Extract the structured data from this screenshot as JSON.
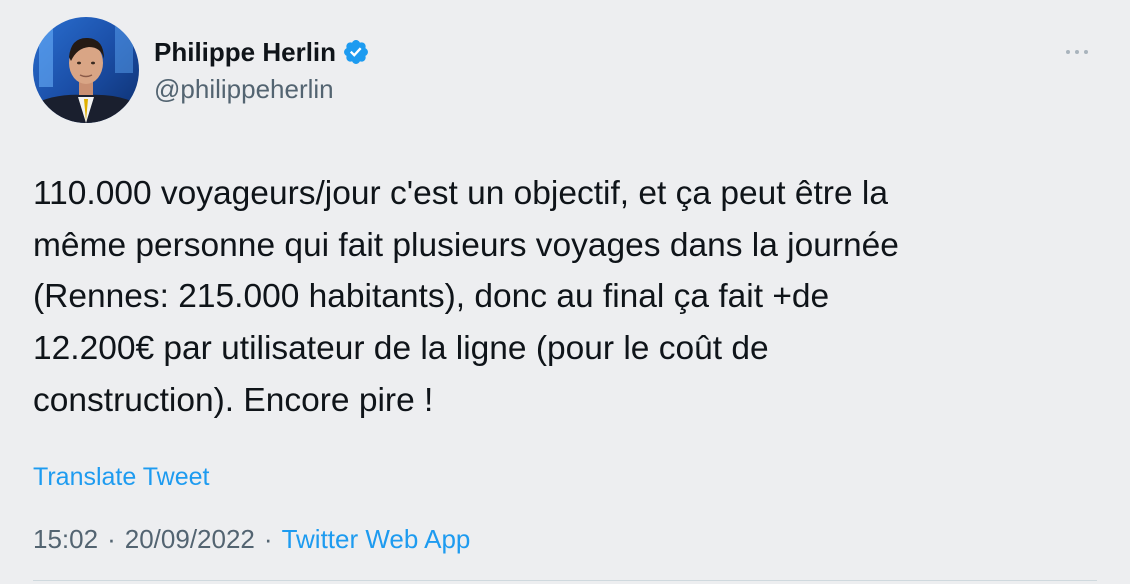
{
  "author": {
    "display_name": "Philippe Herlin",
    "handle": "@philippeherlin",
    "verified": true,
    "verified_color": "#1d9bf0"
  },
  "tweet": {
    "text": "110.000 voyageurs/jour c'est un objectif, et ça peut être la\nmême personne qui fait plusieurs voyages dans la journée\n(Rennes: 215.000 habitants), donc au final ça fait +de\n12.200€ par utilisateur de la ligne (pour le coût de\nconstruction). Encore pire !",
    "translate_label": "Translate Tweet",
    "time": "15:02",
    "date": "20/09/2022",
    "separator": "·",
    "source": "Twitter Web App"
  },
  "icons": {
    "more": "more-dots-icon",
    "verified": "verified-badge-icon"
  },
  "colors": {
    "background": "#edeef0",
    "link": "#1d9bf0",
    "secondary_text": "#536471",
    "primary_text": "#0f1419"
  }
}
